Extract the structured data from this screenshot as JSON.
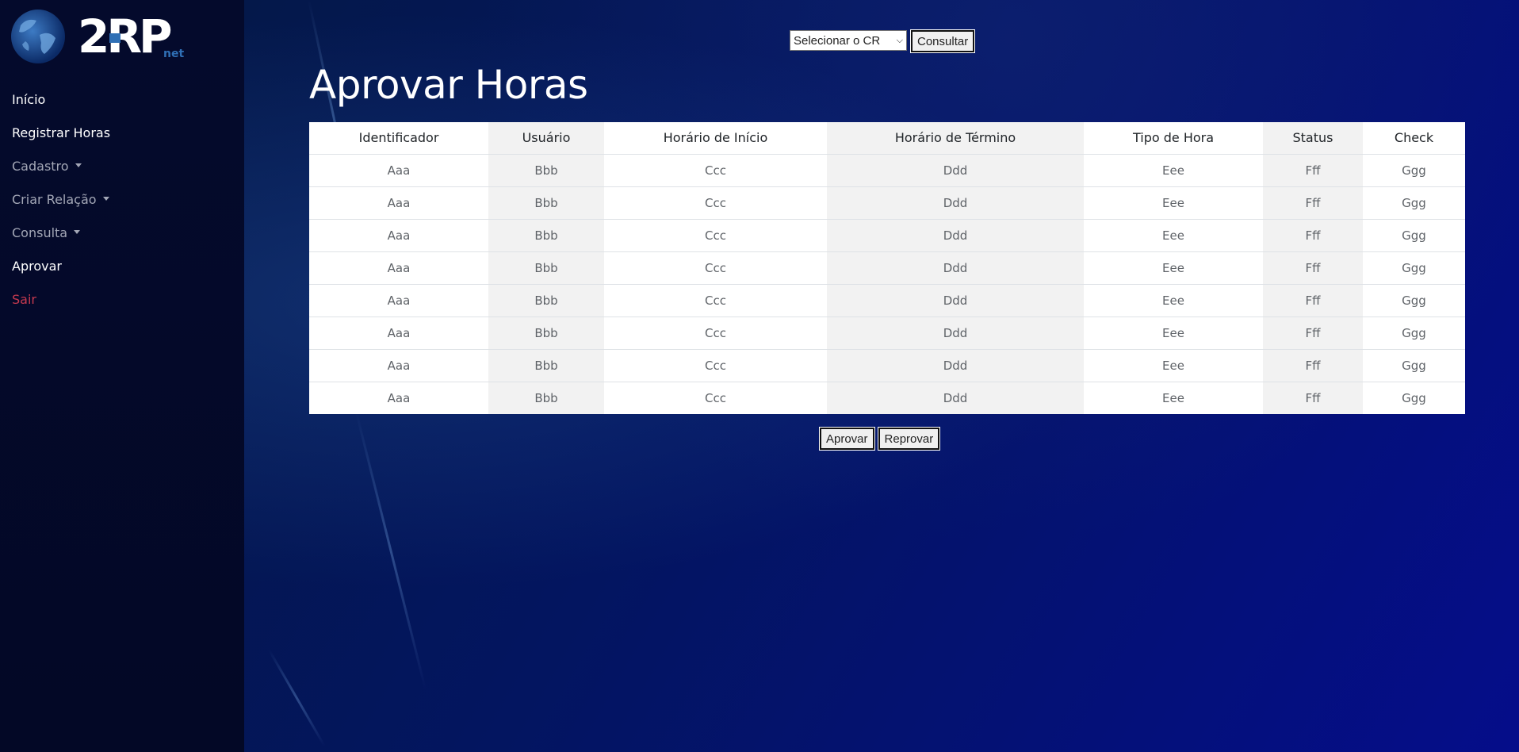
{
  "logo": {
    "text": "2RP",
    "subtext": "net",
    "accent": "#2f6fb5"
  },
  "sidebar": {
    "items": [
      {
        "label": "Início",
        "dropdown": false,
        "tone": "white"
      },
      {
        "label": "Registrar Horas",
        "dropdown": false,
        "tone": "white"
      },
      {
        "label": "Cadastro",
        "dropdown": true,
        "tone": "muted"
      },
      {
        "label": "Criar Relação",
        "dropdown": true,
        "tone": "muted"
      },
      {
        "label": "Consulta",
        "dropdown": true,
        "tone": "muted"
      },
      {
        "label": "Aprovar",
        "dropdown": false,
        "tone": "white"
      },
      {
        "label": "Sair",
        "dropdown": false,
        "tone": "danger"
      }
    ]
  },
  "filter": {
    "select_value": "Selecionar o CR",
    "consult_label": "Consultar"
  },
  "page_title": "Aprovar Horas",
  "table": {
    "headers": [
      "Identificador",
      "Usuário",
      "Horário de Início",
      "Horário de Término",
      "Tipo de Hora",
      "Status",
      "Check"
    ],
    "rows": [
      [
        "Aaa",
        "Bbb",
        "Ccc",
        "Ddd",
        "Eee",
        "Fff",
        "Ggg"
      ],
      [
        "Aaa",
        "Bbb",
        "Ccc",
        "Ddd",
        "Eee",
        "Fff",
        "Ggg"
      ],
      [
        "Aaa",
        "Bbb",
        "Ccc",
        "Ddd",
        "Eee",
        "Fff",
        "Ggg"
      ],
      [
        "Aaa",
        "Bbb",
        "Ccc",
        "Ddd",
        "Eee",
        "Fff",
        "Ggg"
      ],
      [
        "Aaa",
        "Bbb",
        "Ccc",
        "Ddd",
        "Eee",
        "Fff",
        "Ggg"
      ],
      [
        "Aaa",
        "Bbb",
        "Ccc",
        "Ddd",
        "Eee",
        "Fff",
        "Ggg"
      ],
      [
        "Aaa",
        "Bbb",
        "Ccc",
        "Ddd",
        "Eee",
        "Fff",
        "Ggg"
      ],
      [
        "Aaa",
        "Bbb",
        "Ccc",
        "Ddd",
        "Eee",
        "Fff",
        "Ggg"
      ]
    ]
  },
  "actions": {
    "approve_label": "Aprovar",
    "reject_label": "Reprovar"
  },
  "colors": {
    "sidebar_bg": "#040a2c",
    "danger": "#c5394f",
    "muted": "#a3a7b6"
  }
}
